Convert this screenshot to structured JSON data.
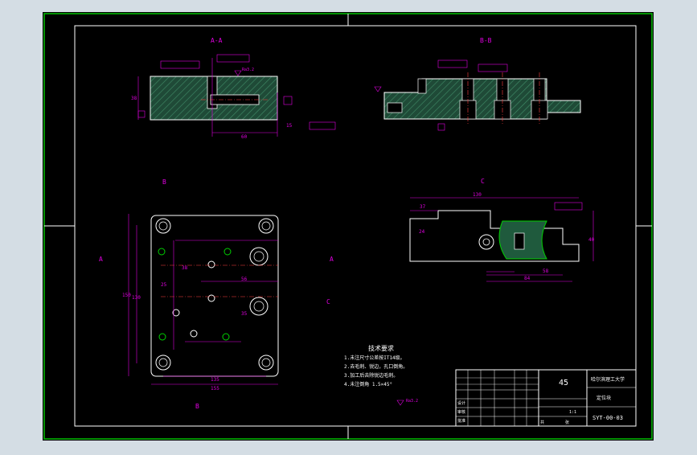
{
  "drawing": {
    "views": {
      "section_aa": "A-A",
      "section_bb": "B-B",
      "view_c": "C",
      "label_a_left": "A",
      "label_a_right": "A",
      "label_b_top": "B",
      "label_b_bottom": "B",
      "label_c": "C"
    },
    "dimensions": {
      "aa_height": "38",
      "aa_length": "60",
      "aa_right": "15",
      "aa_side_1": "22",
      "aa_side_2": "18",
      "c_length": "130",
      "c_left": "37",
      "c_height": "24",
      "c_right": "40",
      "c_bottom_a": "34",
      "c_bottom_b": "58",
      "c_bottom_c": "84",
      "c_small": "25",
      "main_w1": "135",
      "main_w2": "155",
      "main_h1": "130",
      "main_h2": "150",
      "main_d1": "38",
      "main_d2": "56",
      "main_d3": "35",
      "main_d4": "30",
      "main_d5": "25",
      "main_d6": "12",
      "main_d7": "20",
      "main_d8": "40"
    },
    "notes": {
      "heading": "技术要求",
      "line1": "1.未注尺寸公差按IT14级。",
      "line2": "2.去毛刺、锐边，孔口倒角。",
      "line3": "3.加工后去除锐边毛刺。",
      "line4": "4.未注倒角 1.5×45°"
    },
    "roughness": "Ra3.2"
  },
  "title_block": {
    "material": "45",
    "school": "哈尔滨理工大学",
    "part_name": "定位块",
    "drawing_no": "SYT-00-03",
    "scale": "1:1",
    "qty_label": "共",
    "sheet_label": "张",
    "design_label": "设计",
    "check_label": "审核",
    "approve_label": "批准"
  },
  "colors": {
    "background": "#000000",
    "frame": "#ffffff",
    "outer_border": "#00c000",
    "dimension": "#e000e0",
    "hatch": "#2e6b4f",
    "geometry": "#ffffff",
    "centerline": "#ff4040",
    "green_line": "#00d000"
  }
}
